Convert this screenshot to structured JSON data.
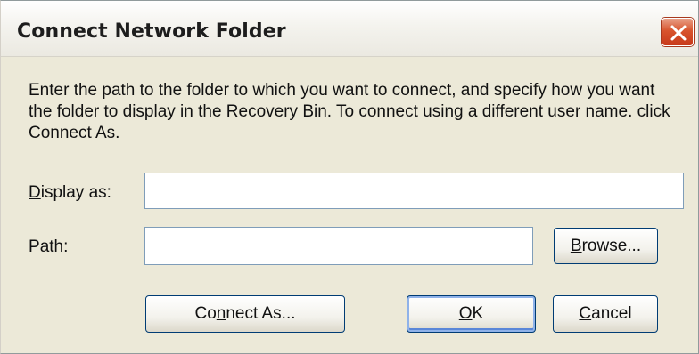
{
  "dialog": {
    "title": "Connect Network Folder",
    "description": "Enter the path to the folder to which you want to connect, and specify how you want the folder to display in the Recovery Bin. To connect using a different user name. click Connect As.",
    "display_as": {
      "label_mnemonic": "D",
      "label_rest": "isplay as:",
      "value": ""
    },
    "path": {
      "label_mnemonic": "P",
      "label_rest": "ath:",
      "value": ""
    },
    "buttons": {
      "browse": {
        "mnemonic": "B",
        "rest": "rowse..."
      },
      "connect_as": {
        "pre": "Co",
        "mnemonic": "n",
        "rest": "nect As..."
      },
      "ok": {
        "mnemonic": "O",
        "rest": "K"
      },
      "cancel": {
        "mnemonic": "C",
        "rest": "ancel"
      }
    },
    "colors": {
      "close_button": "#d8542d",
      "default_button_focus": "#8fb2e9"
    },
    "icons": {
      "close": "close-icon"
    }
  }
}
